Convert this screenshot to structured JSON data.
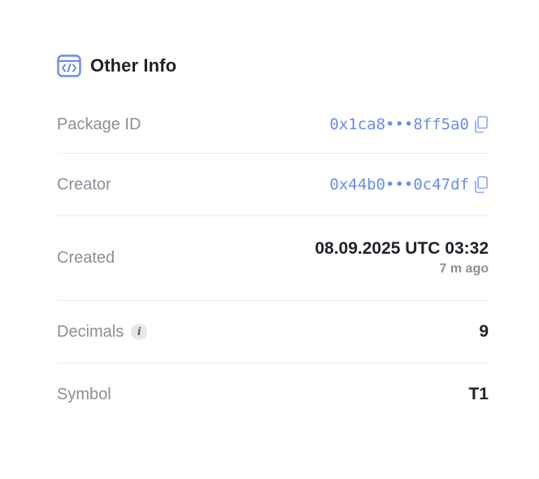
{
  "section": {
    "title": "Other Info",
    "icon": "code-window-icon",
    "accent_color": "#6b8bef"
  },
  "rows": {
    "package_id": {
      "label": "Package ID",
      "value": "0x1ca8•••8ff5a0",
      "icon": "copy-icon"
    },
    "creator": {
      "label": "Creator",
      "value": "0x44b0•••0c47df",
      "icon": "copy-icon"
    },
    "created": {
      "label": "Created",
      "value": "08.09.2025 UTC 03:32",
      "relative": "7 m ago"
    },
    "decimals": {
      "label": "Decimals",
      "info_glyph": "i",
      "value": "9"
    },
    "symbol": {
      "label": "Symbol",
      "value": "T1"
    }
  }
}
